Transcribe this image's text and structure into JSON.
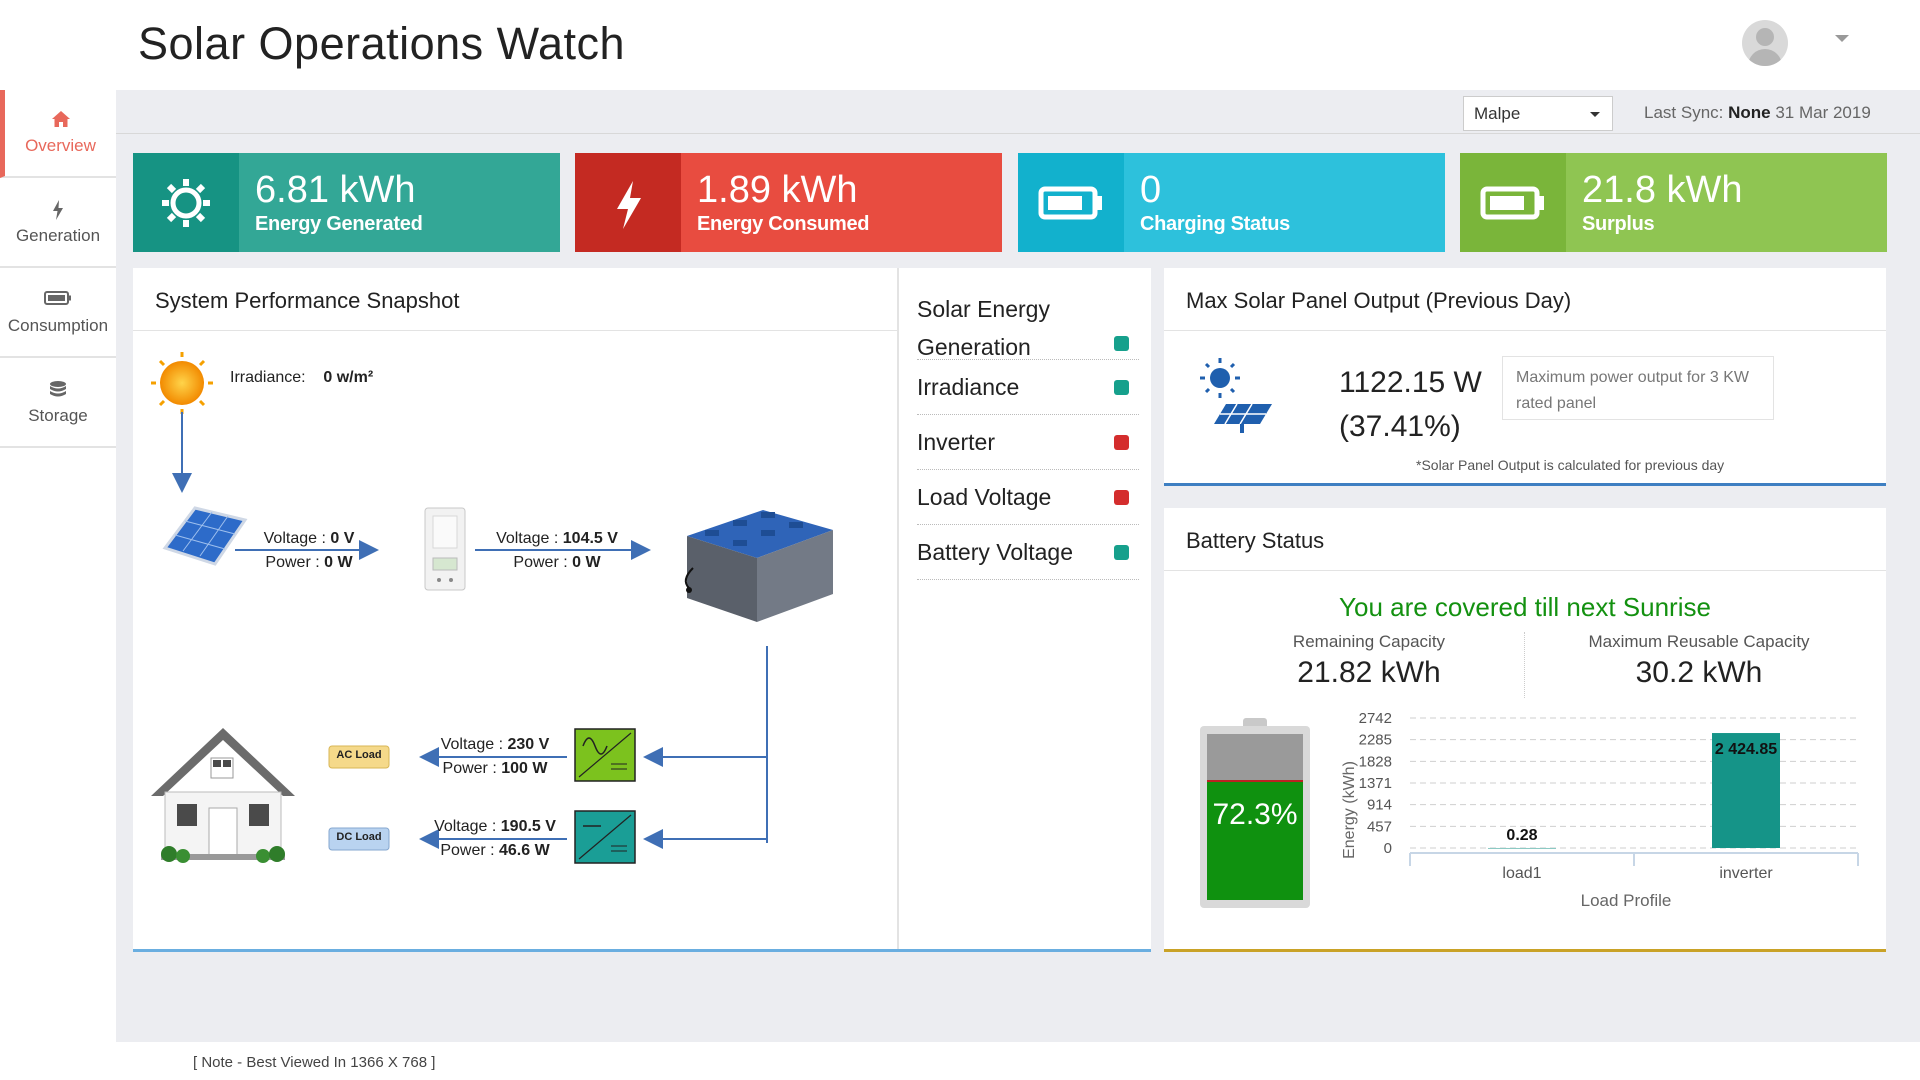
{
  "app": {
    "title": "Solar Operations Watch"
  },
  "header": {
    "avatar": "user-avatar-icon"
  },
  "sidebar": {
    "items": [
      {
        "label": "Overview",
        "icon": "home-icon",
        "active": true
      },
      {
        "label": "Generation",
        "icon": "bolt-icon"
      },
      {
        "label": "Consumption",
        "icon": "battery-icon"
      },
      {
        "label": "Storage",
        "icon": "database-icon"
      }
    ]
  },
  "toolbar": {
    "location": "Malpe",
    "sync_label": "Last Sync:",
    "sync_value": "None",
    "sync_date": "31 Mar 2019"
  },
  "kpis": [
    {
      "value": "6.81 kWh",
      "label": "Energy Generated",
      "color": "#33a796",
      "icon_bg": "#169383",
      "icon": "sun-gear-icon"
    },
    {
      "value": "1.89 kWh",
      "label": "Energy Consumed",
      "color": "#e84c40",
      "icon_bg": "#c42a22",
      "icon": "bolt-icon"
    },
    {
      "value": "0",
      "label": "Charging Status",
      "color": "#2dc1dc",
      "icon_bg": "#12b1cd",
      "icon": "battery-icon"
    },
    {
      "value": "21.8 kWh",
      "label": "Surplus",
      "color": "#8fc552",
      "icon_bg": "#7ab53a",
      "icon": "battery-icon"
    }
  ],
  "snapshot": {
    "title": "System Performance Snapshot",
    "irradiance_label": "Irradiance:",
    "irradiance_value": "0 w/m²",
    "panel_voltage_label": "Voltage : ",
    "panel_voltage": "0 V",
    "panel_power_label": "Power : ",
    "panel_power": "0 W",
    "inverter_voltage_label": "Voltage : ",
    "inverter_voltage": "104.5 V",
    "inverter_power_label": "Power : ",
    "inverter_power": "0 W",
    "ac_tag": "AC Load",
    "ac_voltage_label": "Voltage : ",
    "ac_voltage": "230 V",
    "ac_power_label": "Power : ",
    "ac_power": "100 W",
    "dc_tag": "DC Load",
    "dc_voltage_label": "Voltage : ",
    "dc_voltage": "190.5 V",
    "dc_power_label": "Power : ",
    "dc_power": "46.6 W"
  },
  "status_list": [
    {
      "label_line1": "Solar Energy",
      "label_line2": "Generation",
      "status": "ok",
      "color": "#16a08c"
    },
    {
      "label_line1": "Irradiance",
      "status": "ok",
      "color": "#16a08c"
    },
    {
      "label_line1": "Inverter",
      "status": "fault",
      "color": "#d42d2d"
    },
    {
      "label_line1": "Load Voltage",
      "status": "fault",
      "color": "#d42d2d"
    },
    {
      "label_line1": "Battery Voltage",
      "status": "ok",
      "color": "#16a08c"
    }
  ],
  "max_output": {
    "title": "Max Solar Panel Output (Previous Day)",
    "value": "1122.15 W",
    "percent": "(37.41%)",
    "info": "Maximum power output for 3 KW rated panel",
    "footnote": "*Solar Panel Output is calculated for previous day"
  },
  "battery": {
    "title": "Battery Status",
    "headline": "You are covered till next Sunrise",
    "remaining_label": "Remaining Capacity",
    "remaining_value": "21.82 kWh",
    "max_label": "Maximum Reusable Capacity",
    "max_value": "30.2 kWh",
    "charge_percent": 72.3,
    "charge_label": "72.3%"
  },
  "chart_data": {
    "type": "bar",
    "categories": [
      "load1",
      "inverter"
    ],
    "values": [
      0.28,
      2424.85
    ],
    "value_labels": [
      "0.28",
      "2 424.85"
    ],
    "ylabel": "Energy (kWh)",
    "xlabel": "Load Profile",
    "yticks": [
      0,
      457,
      914,
      1371,
      1828,
      2285,
      2742
    ],
    "ylim": [
      0,
      2742
    ],
    "grid": true,
    "bar_color": "#159488"
  },
  "footer": {
    "note": "[ Note - Best Viewed In 1366 X 768 ]"
  }
}
